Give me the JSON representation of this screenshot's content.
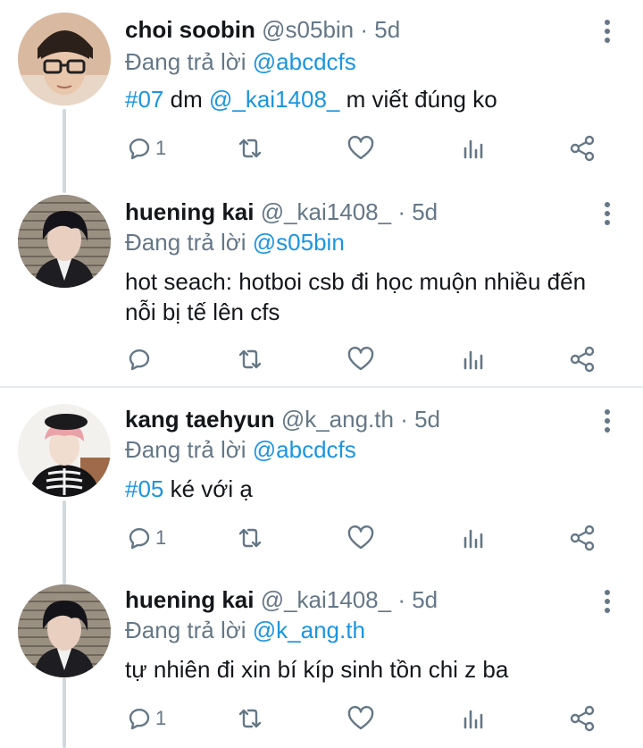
{
  "reply_prefix": "Đang trả lời ",
  "tweets": [
    {
      "name": "choi soobin",
      "meta": "@s05bin · 5d",
      "reply_to": "@abcdcfs",
      "tag": "#07",
      "text_a": " dm ",
      "mention": "@_kai1408_",
      "text_b": " m viết đúng ko",
      "reply_count": "1"
    },
    {
      "name": "huening kai",
      "meta": "@_kai1408_ · 5d",
      "reply_to": "@s05bin",
      "text": "hot seach: hotboi csb đi học muộn nhiều đến nỗi bị tế lên cfs",
      "reply_count": ""
    },
    {
      "name": "kang taehyun",
      "meta": "@k_ang.th · 5d",
      "reply_to": "@abcdcfs",
      "tag": "#05",
      "text": " ké với ạ",
      "reply_count": "1"
    },
    {
      "name": "huening kai",
      "meta": "@_kai1408_ · 5d",
      "reply_to": "@k_ang.th",
      "text": "tự nhiên đi xin bí kíp sinh tồn chi z ba",
      "reply_count": "1"
    }
  ],
  "colors": {
    "accent": "#1b95e0",
    "secondary_text": "#657786",
    "primary_text": "#14171a",
    "thread_line": "#cfd9de",
    "divider": "#e6ecf0"
  },
  "icons": [
    "reply-icon",
    "retweet-icon",
    "like-icon",
    "stats-icon",
    "share-icon",
    "more-options-icon"
  ]
}
